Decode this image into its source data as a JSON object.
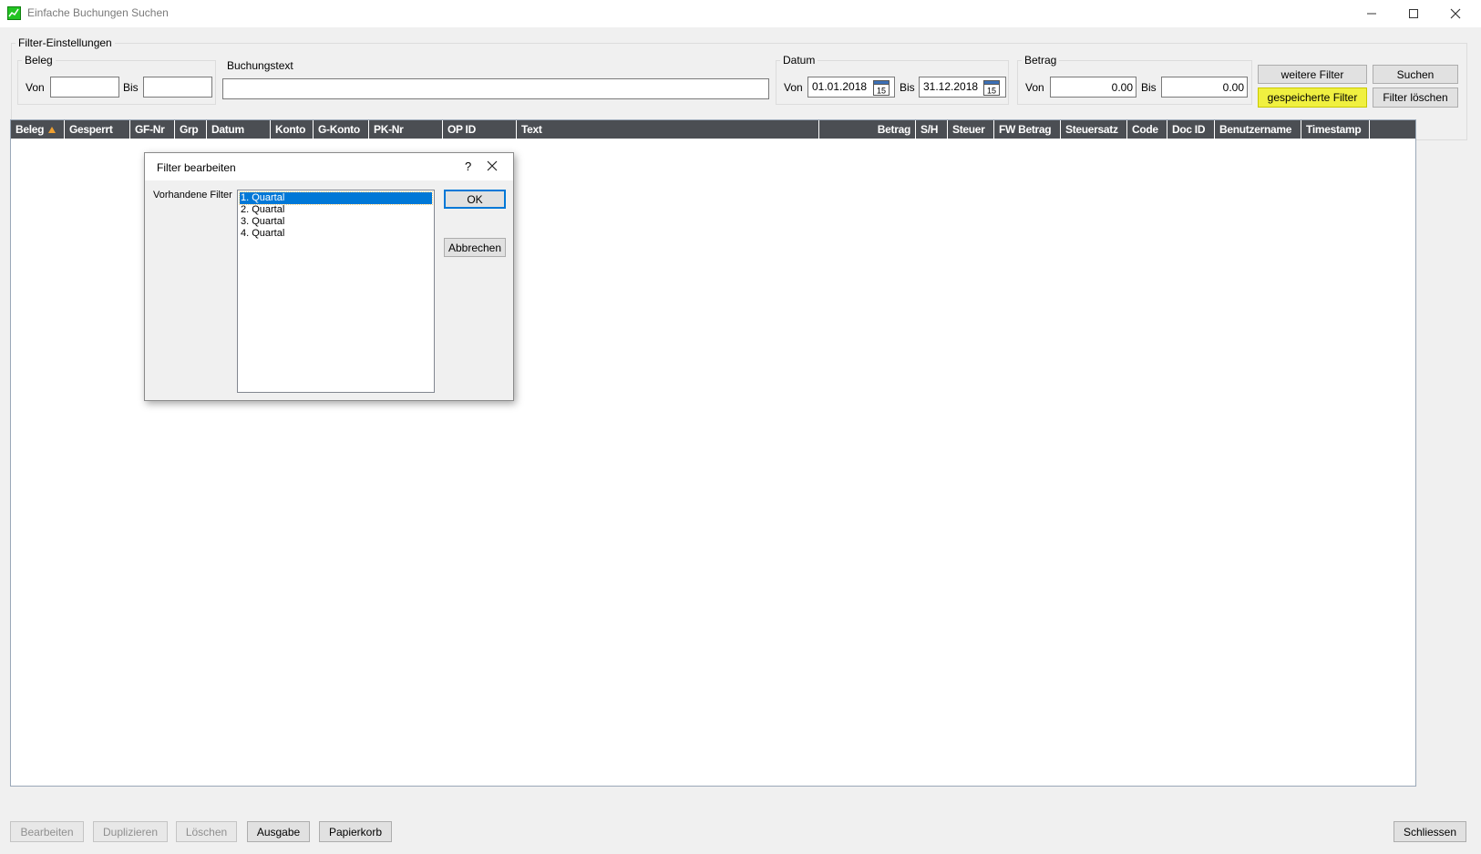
{
  "window": {
    "title": "Einfache Buchungen Suchen",
    "controls": {
      "minimize": "minimize-icon",
      "maximize": "maximize-icon",
      "close": "close-icon"
    }
  },
  "filter": {
    "group_label": "Filter-Einstellungen",
    "beleg": {
      "label": "Beleg",
      "von_label": "Von",
      "bis_label": "Bis",
      "von_value": "",
      "bis_value": ""
    },
    "buchungstext": {
      "label": "Buchungstext",
      "value": ""
    },
    "datum": {
      "label": "Datum",
      "von_label": "Von",
      "von_value": "01.01.2018",
      "bis_label": "Bis",
      "bis_value": "31.12.2018",
      "calendar_day": "15"
    },
    "betrag": {
      "label": "Betrag",
      "von_label": "Von",
      "von_value": "0.00",
      "bis_label": "Bis",
      "bis_value": "0.00"
    },
    "buttons": {
      "weitere": "weitere Filter",
      "suchen": "Suchen",
      "gespeicherte": "gespeicherte Filter",
      "loeschen": "Filter löschen"
    },
    "highlight_color": "#f0f040"
  },
  "grid": {
    "header_bg": "#4b4e53",
    "sort_indicator_color": "#f0a030",
    "columns": [
      "Beleg",
      "Gesperrt",
      "GF-Nr",
      "Grp",
      "Datum",
      "Konto",
      "G-Konto",
      "PK-Nr",
      "OP ID",
      "Text",
      "Betrag",
      "S/H",
      "Steuer",
      "FW Betrag",
      "Steuersatz",
      "Code",
      "Doc ID",
      "Benutzername",
      "Timestamp"
    ]
  },
  "dialog": {
    "title": "Filter bearbeiten",
    "help": "?",
    "list_label": "Vorhandene Filter",
    "items": [
      "1. Quartal",
      "2. Quartal",
      "3. Quartal",
      "4. Quartal"
    ],
    "selected_index": 0,
    "ok": "OK",
    "cancel": "Abbrechen"
  },
  "bottom_buttons": {
    "bearbeiten": "Bearbeiten",
    "duplizieren": "Duplizieren",
    "loeschen": "Löschen",
    "ausgabe": "Ausgabe",
    "papierkorb": "Papierkorb",
    "schliessen": "Schliessen"
  }
}
